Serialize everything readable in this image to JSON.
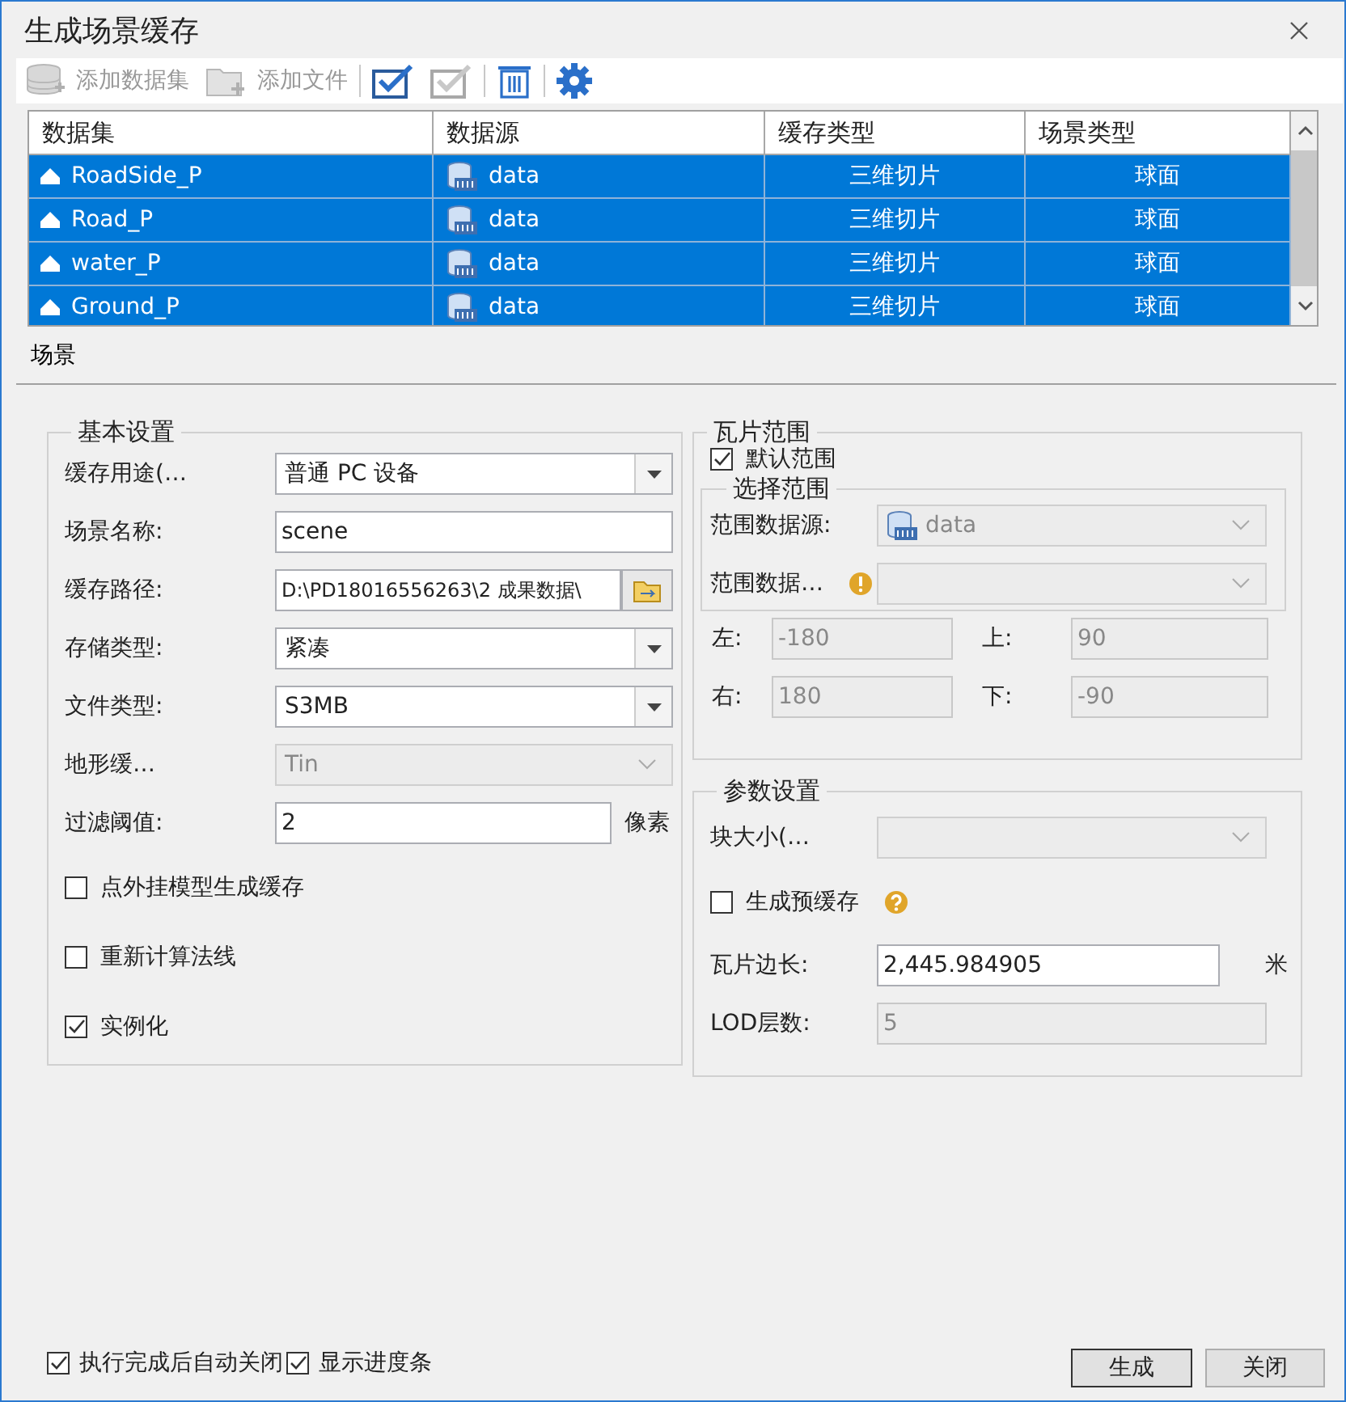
{
  "window": {
    "title": "生成场景缓存"
  },
  "toolbar": [
    {
      "kind": "dataset",
      "label": "添加数据集",
      "disabled": true
    },
    {
      "kind": "folder",
      "label": "添加文件",
      "disabled": true
    },
    {
      "kind": "checkall",
      "disabled": false
    },
    {
      "kind": "checknone",
      "disabled": true
    },
    {
      "kind": "delete",
      "disabled": false
    },
    {
      "kind": "settings",
      "disabled": false
    }
  ],
  "table": {
    "columns": [
      "数据集",
      "数据源",
      "缓存类型",
      "场景类型"
    ],
    "rows": [
      {
        "selected": true,
        "dataset": "RoadSide_P",
        "datasource": "data",
        "cache_type": "三维切片",
        "scene_type": "球面"
      },
      {
        "selected": true,
        "dataset": "Road_P",
        "datasource": "data",
        "cache_type": "三维切片",
        "scene_type": "球面"
      },
      {
        "selected": true,
        "dataset": "water_P",
        "datasource": "data",
        "cache_type": "三维切片",
        "scene_type": "球面"
      },
      {
        "selected": true,
        "dataset": "Ground_P",
        "datasource": "data",
        "cache_type": "三维切片",
        "scene_type": "球面"
      }
    ]
  },
  "tabs": [
    {
      "label": "场景",
      "selected": true
    }
  ],
  "basic_settings": {
    "title": "基本设置",
    "fields": [
      {
        "kind": "dropdown",
        "label": "缓存用途(…",
        "value": "普通 PC 设备",
        "disabled": false
      },
      {
        "kind": "text",
        "label": "场景名称:",
        "value": "scene",
        "disabled": false
      },
      {
        "kind": "path",
        "label": "缓存路径:",
        "value": "D:\\PD18016556263\\2 成果数据\\",
        "disabled": false
      },
      {
        "kind": "dropdown",
        "label": "存储类型:",
        "value": "紧凑",
        "disabled": false
      },
      {
        "kind": "dropdown",
        "label": "文件类型:",
        "value": "S3MB",
        "disabled": false
      },
      {
        "kind": "dropdown",
        "label": "地形缓…",
        "value": "Tin",
        "disabled": true
      },
      {
        "kind": "text",
        "label": "过滤阈值:",
        "value": "2",
        "unit": "像素",
        "disabled": false
      },
      {
        "kind": "checkbox",
        "label": "点外挂模型生成缓存",
        "checked": false
      },
      {
        "kind": "checkbox",
        "label": "重新计算法线",
        "checked": false
      },
      {
        "kind": "checkbox",
        "label": "实例化",
        "checked": true
      }
    ]
  },
  "tile_range": {
    "title": "瓦片范围",
    "default_range": {
      "label": "默认范围",
      "checked": true
    },
    "select_range": {
      "title": "选择范围",
      "fields": [
        {
          "kind": "datasource",
          "label": "范围数据源:",
          "value": "data",
          "disabled": true
        },
        {
          "kind": "dropdown",
          "label": "范围数据…",
          "warning": true,
          "disabled": true
        }
      ]
    },
    "bounds": [
      {
        "label": "左:",
        "value": "-180",
        "disabled": true
      },
      {
        "label": "上:",
        "value": "90",
        "disabled": true
      },
      {
        "label": "右:",
        "value": "180",
        "disabled": true
      },
      {
        "label": "下:",
        "value": "-90",
        "disabled": true
      }
    ]
  },
  "params": {
    "title": "参数设置",
    "fields": [
      {
        "kind": "dropdown",
        "label": "块大小(…",
        "disabled": true
      },
      {
        "kind": "checkbox",
        "label": "生成预缓存",
        "checked": false,
        "help": true
      },
      {
        "kind": "text",
        "label": "瓦片边长:",
        "value": "2,445.984905",
        "unit": "米",
        "disabled": false
      },
      {
        "kind": "text",
        "label": "LOD层数:",
        "value": "5",
        "disabled": true
      }
    ]
  },
  "footer": {
    "options": [
      {
        "label": "执行完成后自动关闭",
        "checked": true
      },
      {
        "label": "显示进度条",
        "checked": true
      }
    ],
    "buttons": [
      {
        "label": "生成",
        "default": true
      },
      {
        "label": "关闭",
        "default": false
      }
    ]
  }
}
